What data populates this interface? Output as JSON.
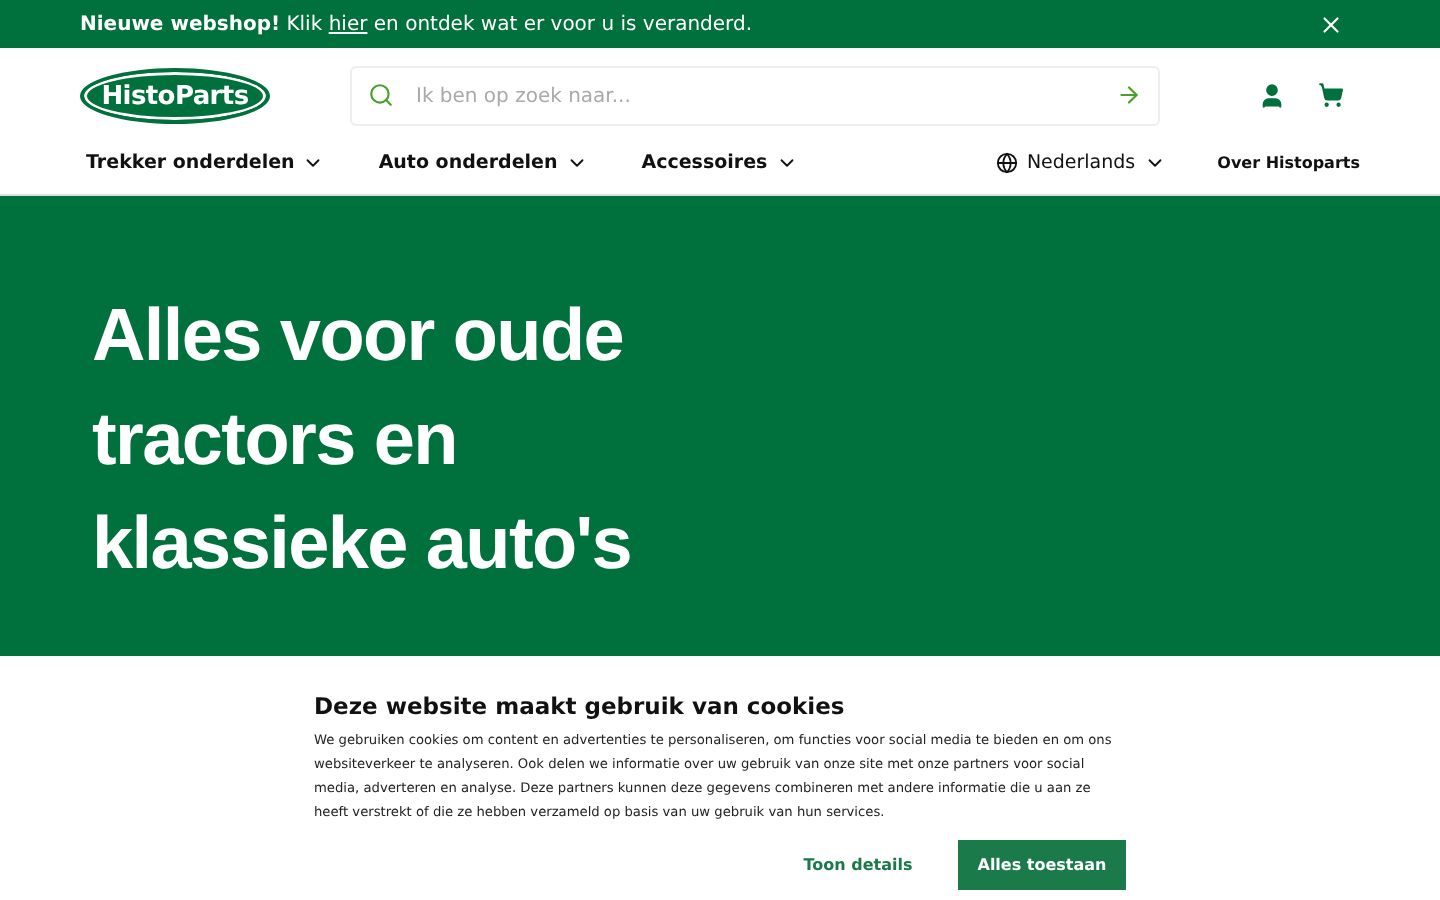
{
  "announcement": {
    "text_before": "**Nieuwe webshop!** Klik",
    "link": "hier",
    "text_after": "en ontdek wat er voor u is veranderd."
  },
  "logo": "HistoParts",
  "search": {
    "placeholder": "Ik ben op zoek naar..."
  },
  "nav": [
    {
      "label": "Trekker onderdelen"
    },
    {
      "label": "Auto onderdelen"
    },
    {
      "label": "Accessoires"
    }
  ],
  "language": "Nederlands",
  "about": "Over Histoparts",
  "hero": {
    "title": "Alles voor oude tractors en klassieke auto's"
  },
  "cookies": {
    "title": "Deze website maakt gebruik van cookies",
    "body": "We gebruiken cookies om content en advertenties te personaliseren, om functies voor social media te bieden en om ons websiteverkeer te analyseren. Ook delen we informatie over uw gebruik van onze site met onze partners voor social media, adverteren en analyse. Deze partners kunnen deze gegevens combineren met andere informatie die u aan ze heeft verstrekt of die ze hebben verzameld op basis van uw gebruik van hun services.",
    "buttons": [
      {
        "label": "Toon details",
        "kind": "text"
      },
      {
        "label": "Alles toestaan",
        "kind": "primary"
      }
    ]
  }
}
